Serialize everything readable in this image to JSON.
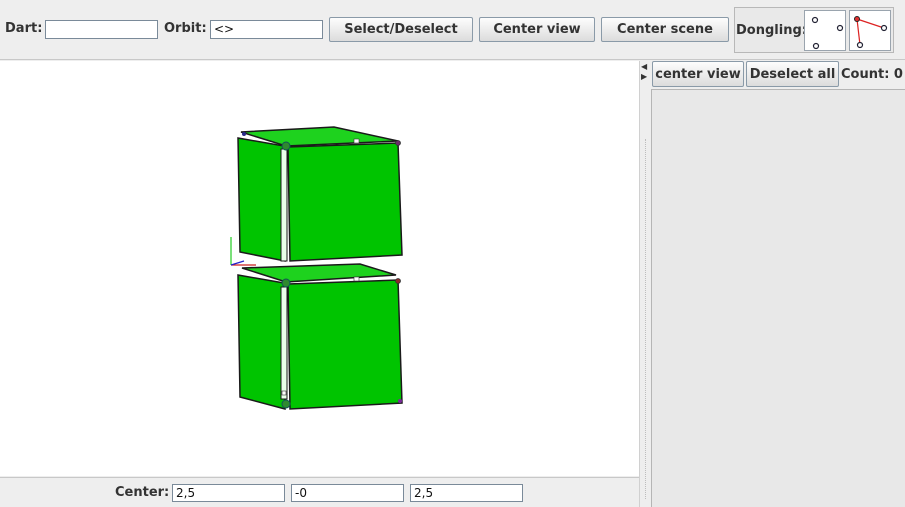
{
  "toolbar": {
    "dart_label": "Dart:",
    "dart_value": "",
    "orbit_label": "Orbit:",
    "orbit_value": "<>",
    "select_deselect": "Select/Deselect",
    "center_view": "Center view",
    "center_scene": "Center scene",
    "dongling_label": "Dongling:"
  },
  "right_panel": {
    "center_view": "center view",
    "deselect_all": "Deselect all",
    "count_label": "Count: 0"
  },
  "center_bar": {
    "label": "Center:",
    "x": "2,5",
    "y": "-0",
    "z": "2,5"
  },
  "colors": {
    "face": "#00c400",
    "face_light": "#1ed21e",
    "edge": "#1a1a1a",
    "vertex": "#3a7a3a"
  }
}
